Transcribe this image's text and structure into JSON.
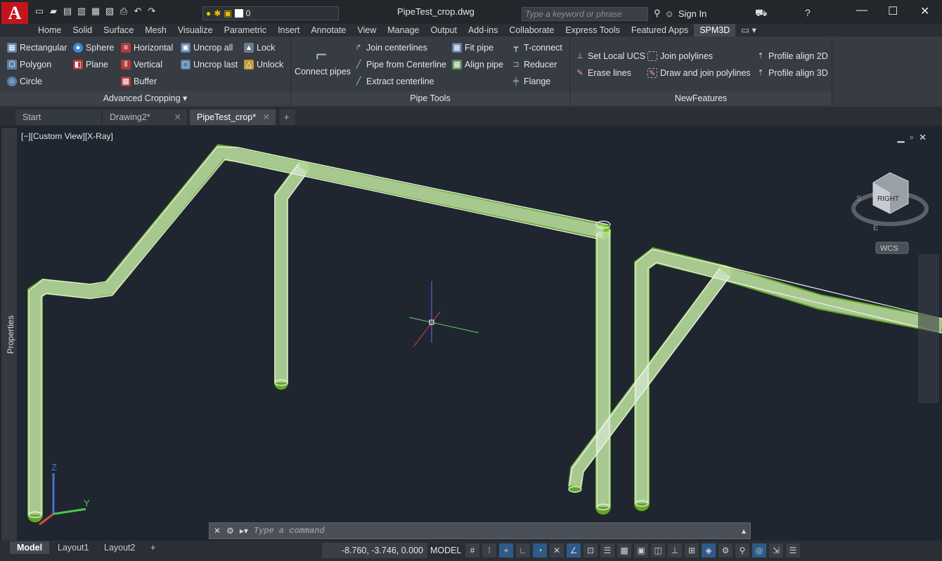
{
  "app": {
    "logo_letter": "A",
    "doc_title": "PipeTest_crop.dwg"
  },
  "titlebar": {
    "layer_value": "0",
    "search_placeholder": "Type a keyword or phrase",
    "signin": "Sign In"
  },
  "menu": {
    "tabs": [
      "Home",
      "Solid",
      "Surface",
      "Mesh",
      "Visualize",
      "Parametric",
      "Insert",
      "Annotate",
      "View",
      "Manage",
      "Output",
      "Add-ins",
      "Collaborate",
      "Express Tools",
      "Featured Apps",
      "SPM3D"
    ],
    "active": "SPM3D"
  },
  "ribbon": {
    "advanced_cropping": {
      "title": "Advanced Cropping",
      "items": [
        "Rectangular",
        "Polygon",
        "Circle",
        "Sphere",
        "Plane",
        "Horizontal",
        "Vertical",
        "Buffer",
        "Uncrop all",
        "Uncrop last",
        "Lock",
        "Unlock"
      ]
    },
    "pipe_tools": {
      "title": "Pipe Tools",
      "items": [
        "Connect pipes",
        "Join centerlines",
        "Pipe from Centerline",
        "Extract centerline",
        "Fit pipe",
        "Align pipe",
        "T-connect",
        "Reducer",
        "Flange"
      ]
    },
    "new_features": {
      "title": "NewFeatures",
      "items": [
        "Set Local UCS",
        "Erase lines",
        "Join polylines",
        "Draw and join polylines",
        "Profile align 2D",
        "Profile align 3D"
      ]
    }
  },
  "file_tabs": [
    "Start",
    "Drawing2*",
    "PipeTest_crop*"
  ],
  "viewport": {
    "label": "[−][Custom View][X-Ray]",
    "viewcube_face": "RIGHT",
    "wcs": "WCS",
    "axis_z": "Z",
    "axis_y": "Y",
    "compass_s": "S",
    "compass_e": "E"
  },
  "left_panel": {
    "label": "Properties"
  },
  "command": {
    "placeholder": "Type a command"
  },
  "status": {
    "layout_tabs": [
      "Model",
      "Layout1",
      "Layout2"
    ],
    "coords": "-8.760, -3.746, 0.000",
    "model": "MODEL"
  },
  "colors": {
    "accent": "#2e5a88",
    "pipe": "#dfe3e8",
    "cloud": "#7ed321",
    "brand": "#c4141b"
  }
}
